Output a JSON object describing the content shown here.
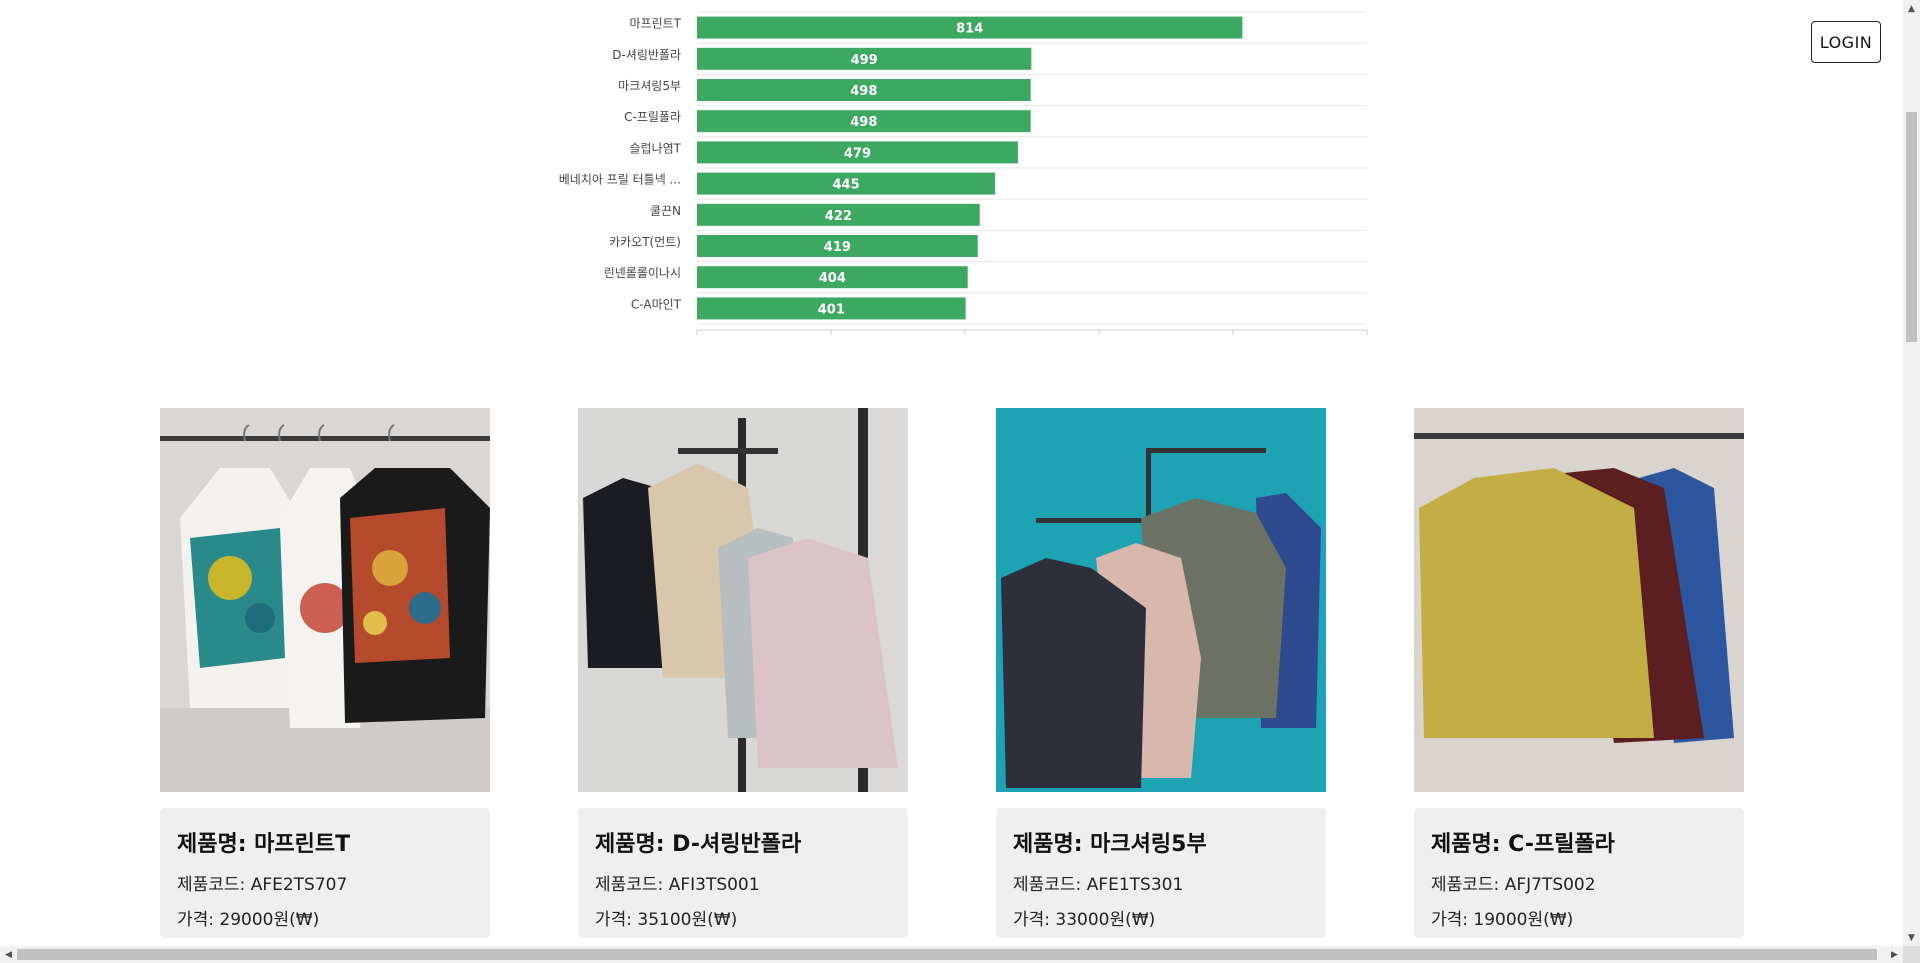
{
  "header": {
    "login_label": "LOGIN"
  },
  "chart_data": {
    "type": "bar",
    "orientation": "horizontal",
    "categories": [
      "마프린트T",
      "D-셔링반폴라",
      "마크셔링5부",
      "C-프릴폴라",
      "슬럽나염T",
      "베네치아 프릴 터틀넥 ...",
      "쿨끈N",
      "카카오T(먼트)",
      "린넨롤롤이나시",
      "C-A마인T"
    ],
    "values": [
      814,
      499,
      498,
      498,
      479,
      445,
      422,
      419,
      404,
      401
    ],
    "xlim": [
      0,
      1000
    ],
    "grid": true,
    "bar_color": "#3da862",
    "label_color": "#ffffff"
  },
  "products": [
    {
      "name_label": "제품명: 마프린트T",
      "code_label": "제품코드: AFE2TS707",
      "price_label": "가격: 29000원(₩)",
      "image": "hanging-printed-tshirts"
    },
    {
      "name_label": "제품명: D-셔링반폴라",
      "code_label": "제품코드: AFI3TS001",
      "price_label": "가격: 35100원(₩)",
      "image": "hanging-turtleneck-tops"
    },
    {
      "name_label": "제품명: 마크셔링5부",
      "code_label": "제품코드: AFE1TS301",
      "price_label": "가격: 33000원(₩)",
      "image": "hanging-shirring-tops-teal-wall"
    },
    {
      "name_label": "제품명: C-프릴폴라",
      "code_label": "제품코드: AFJ7TS002",
      "price_label": "가격: 19000원(₩)",
      "image": "hanging-frill-turtlenecks"
    }
  ],
  "colors": {
    "card_bg": "#efefef",
    "accent": "#3da862"
  }
}
